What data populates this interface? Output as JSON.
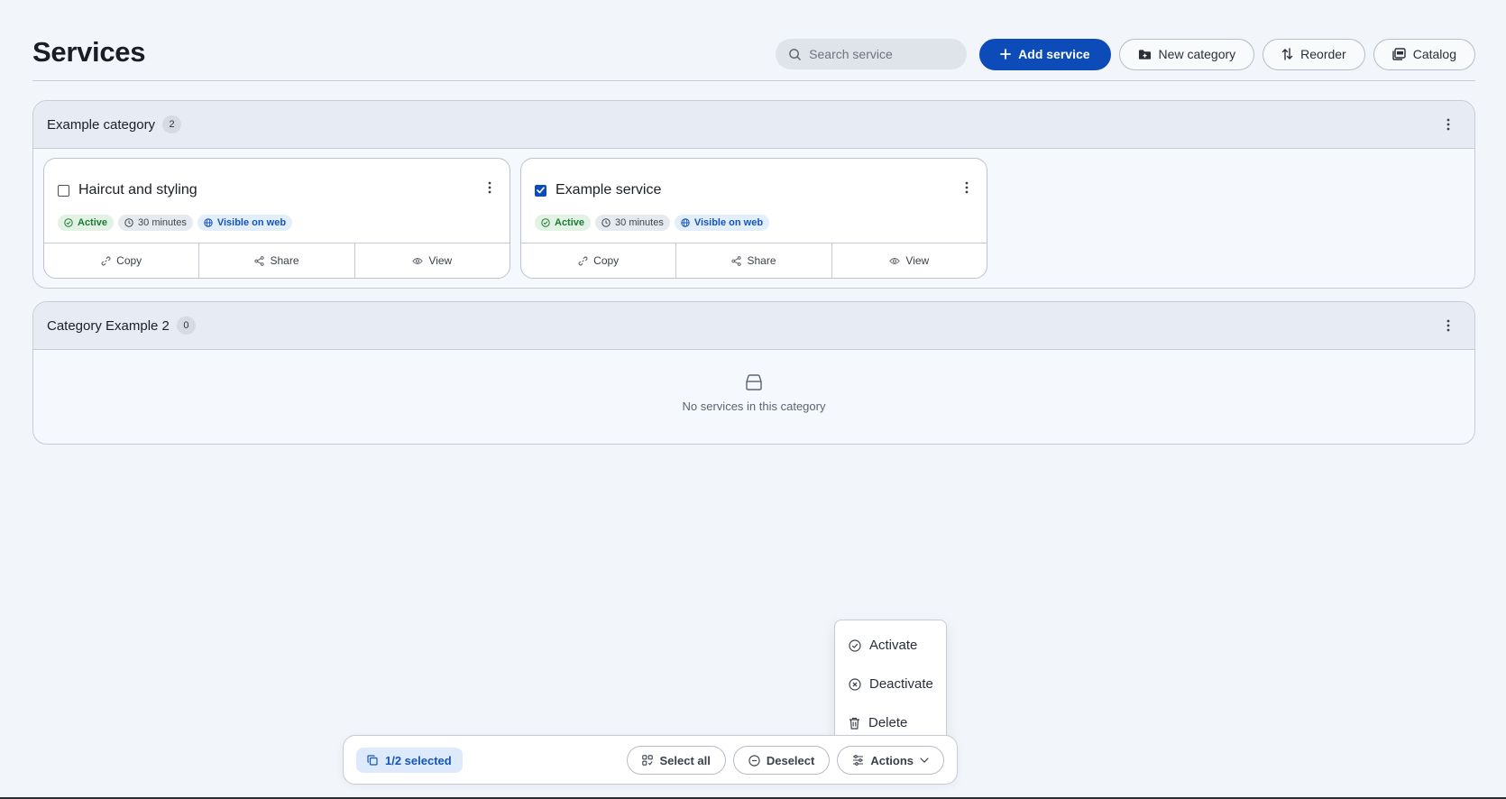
{
  "page": {
    "title": "Services"
  },
  "toolbar": {
    "search_placeholder": "Search service",
    "add_service": "Add service",
    "new_category": "New category",
    "reorder": "Reorder",
    "catalog": "Catalog"
  },
  "categories": [
    {
      "name": "Example category",
      "count": "2",
      "services": [
        {
          "title": "Haircut and styling",
          "checked": false,
          "badges": {
            "status": "Active",
            "duration": "30 minutes",
            "visibility": "Visible on web"
          },
          "actions": {
            "copy": "Copy",
            "share": "Share",
            "view": "View"
          }
        },
        {
          "title": "Example service",
          "checked": true,
          "badges": {
            "status": "Active",
            "duration": "30 minutes",
            "visibility": "Visible on web"
          },
          "actions": {
            "copy": "Copy",
            "share": "Share",
            "view": "View"
          }
        }
      ]
    },
    {
      "name": "Category Example 2",
      "count": "0",
      "empty_text": "No services in this category"
    }
  ],
  "bulk_bar": {
    "selected_label": "1/2 selected",
    "select_all": "Select all",
    "deselect": "Deselect",
    "actions": "Actions"
  },
  "actions_menu": {
    "activate": "Activate",
    "deactivate": "Deactivate",
    "delete": "Delete"
  },
  "colors": {
    "primary": "#0c4bb8",
    "background": "#f2f5fa",
    "active_badge": "#1e7a34",
    "web_badge": "#1654b8"
  }
}
